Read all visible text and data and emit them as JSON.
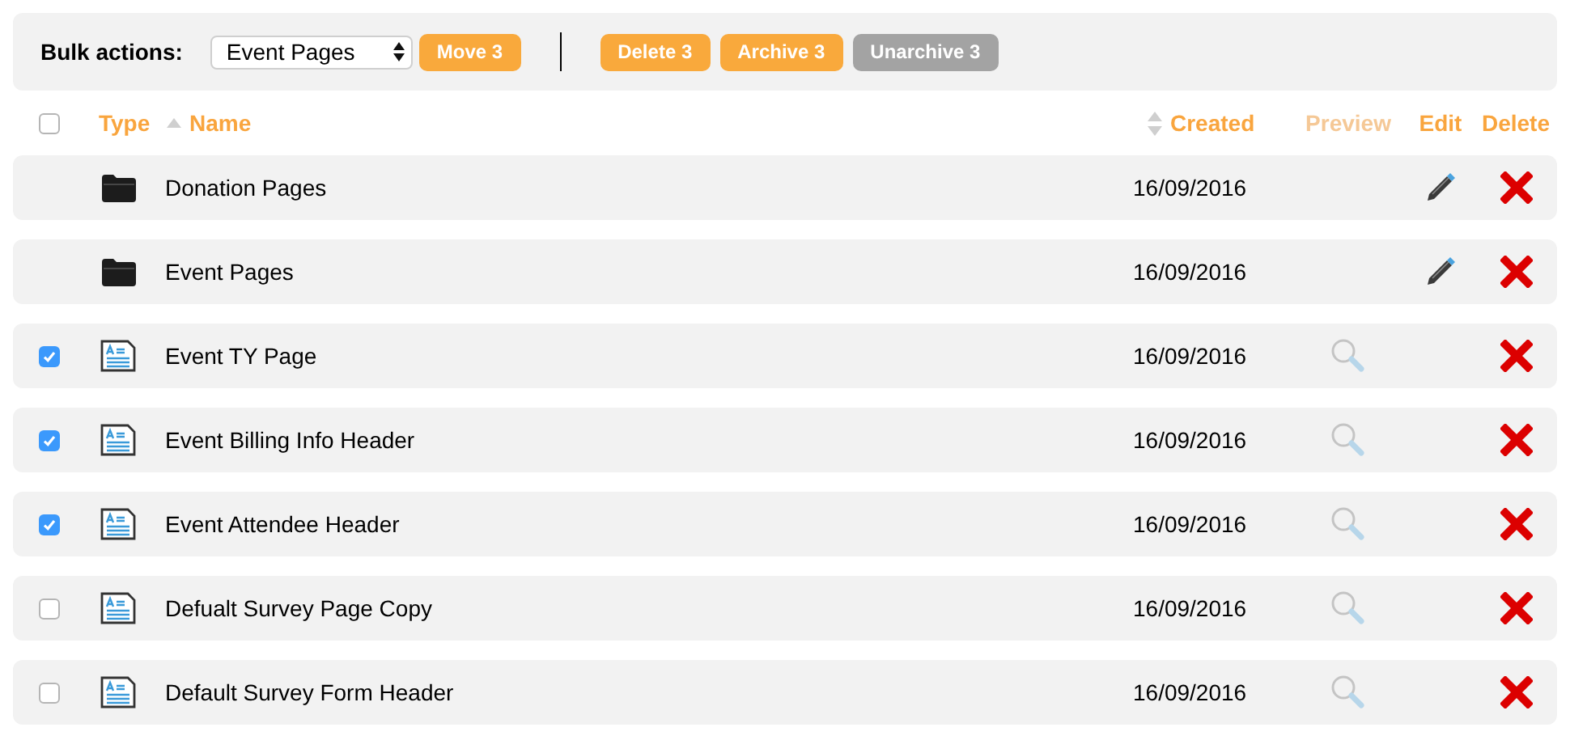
{
  "toolbar": {
    "label": "Bulk actions:",
    "select_value": "Event Pages",
    "move_button": {
      "label": "Move 3",
      "disabled": false
    },
    "action_buttons": [
      {
        "label": "Delete 3",
        "disabled": false
      },
      {
        "label": "Archive 3",
        "disabled": false
      },
      {
        "label": "Unarchive 3",
        "disabled": true
      }
    ]
  },
  "header": {
    "checked": false,
    "columns": [
      {
        "kind": "plain",
        "label": "Type",
        "disabled": false
      },
      {
        "kind": "sortable",
        "label": "Name",
        "sorted": true,
        "disabled": false
      },
      {
        "kind": "sortable",
        "label": "Created",
        "sorted": false,
        "disabled": false
      },
      {
        "kind": "plain",
        "label": "Preview",
        "disabled": true
      },
      {
        "kind": "plain",
        "label": "Edit",
        "disabled": false
      },
      {
        "kind": "plain",
        "label": "Delete",
        "disabled": false
      }
    ]
  },
  "rows": [
    {
      "kind": "folder",
      "name": "Donation Pages",
      "created": "16/09/2016"
    },
    {
      "kind": "folder",
      "name": "Event Pages",
      "created": "16/09/2016"
    },
    {
      "kind": "page",
      "name": "Event TY Page",
      "created": "16/09/2016",
      "checked": true
    },
    {
      "kind": "page",
      "name": "Event Billing Info Header",
      "created": "16/09/2016",
      "checked": true
    },
    {
      "kind": "page",
      "name": "Event Attendee Header",
      "created": "16/09/2016",
      "checked": true
    },
    {
      "kind": "page",
      "name": "Defualt Survey Page Copy",
      "created": "16/09/2016",
      "checked": false
    },
    {
      "kind": "page",
      "name": "Default Survey Form Header",
      "created": "16/09/2016",
      "checked": false
    }
  ]
}
